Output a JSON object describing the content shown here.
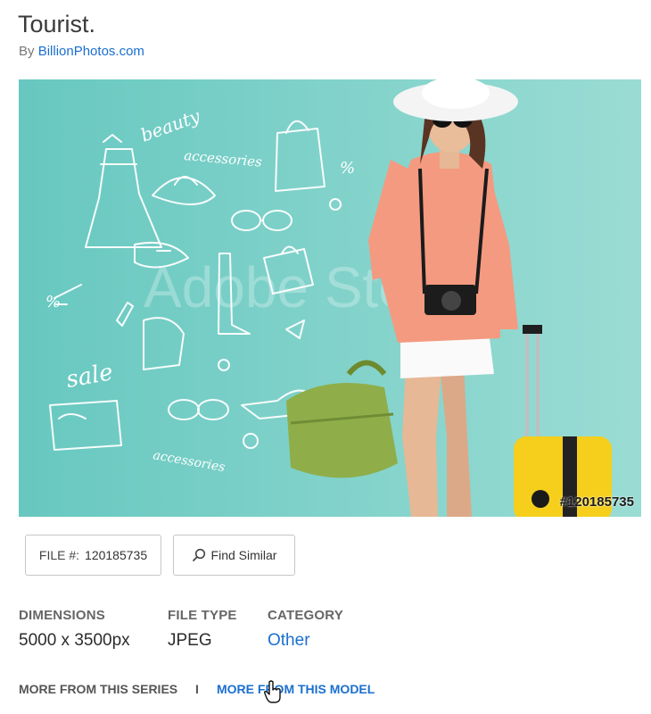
{
  "title": "Tourist.",
  "byline": {
    "prefix": "By",
    "author": "BillionPhotos.com"
  },
  "image": {
    "watermark_text": "Adobe Stock",
    "id_text": "#120185735",
    "doodle_words": [
      "beauty",
      "accessories",
      "sale",
      "accessories",
      "%",
      "%"
    ]
  },
  "buttons": {
    "file_label": "FILE #:",
    "file_number": "120185735",
    "find_similar": "Find Similar"
  },
  "details": {
    "dimensions_label": "DIMENSIONS",
    "dimensions_value": "5000 x 3500px",
    "filetype_label": "FILE TYPE",
    "filetype_value": "JPEG",
    "category_label": "CATEGORY",
    "category_value": "Other"
  },
  "links": {
    "series": "MORE FROM THIS SERIES",
    "separator": "I",
    "model": "MORE FROM THIS MODEL"
  },
  "colors": {
    "background": "#6fcdc5",
    "link": "#1a6fd0"
  },
  "icons": [
    "search-icon",
    "hand-cursor-icon"
  ]
}
